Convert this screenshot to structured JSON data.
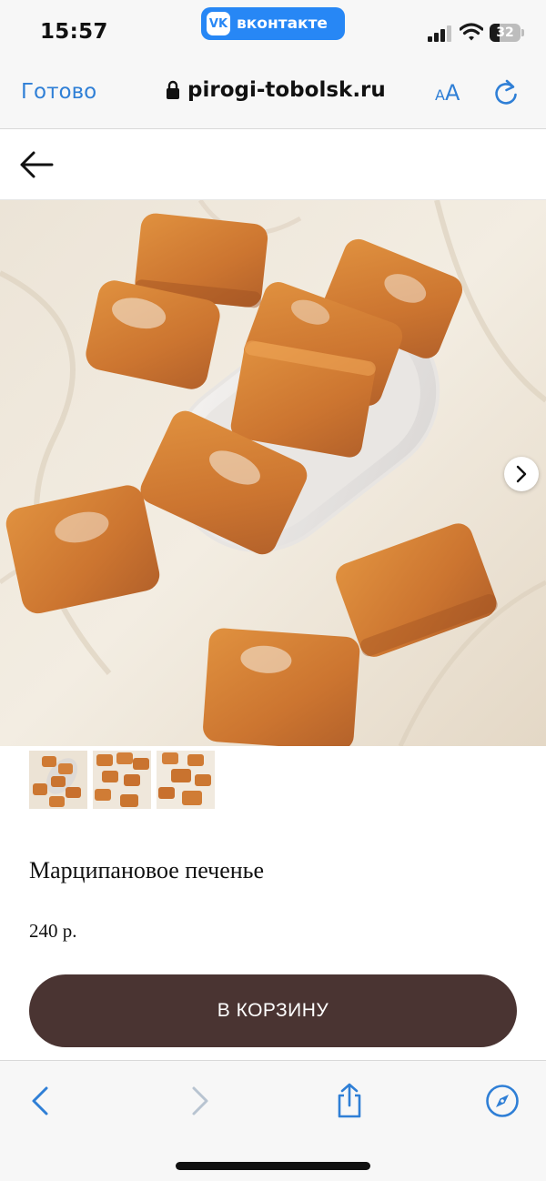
{
  "status_bar": {
    "time": "15:57",
    "app_pill": "вконтакте",
    "app_logo": "VK",
    "battery": "32"
  },
  "browser": {
    "done_label": "Готово",
    "url": "pirogi-tobolsk.ru",
    "text_size_label_small": "A",
    "text_size_label_big": "A"
  },
  "product": {
    "title": "Марципановое печенье",
    "price": "240 р.",
    "add_to_cart_label": "В КОРЗИНУ"
  },
  "icons": {
    "back": "arrow-left-icon",
    "next_image": "chevron-right-icon",
    "lock": "lock-icon",
    "reload": "reload-icon",
    "toolbar": [
      "chevron-left-icon",
      "chevron-right-icon",
      "share-icon",
      "compass-icon"
    ]
  },
  "colors": {
    "accent": "#2f7fd6",
    "vk_brand": "#2787f5",
    "cart_button": "#4a3432"
  }
}
